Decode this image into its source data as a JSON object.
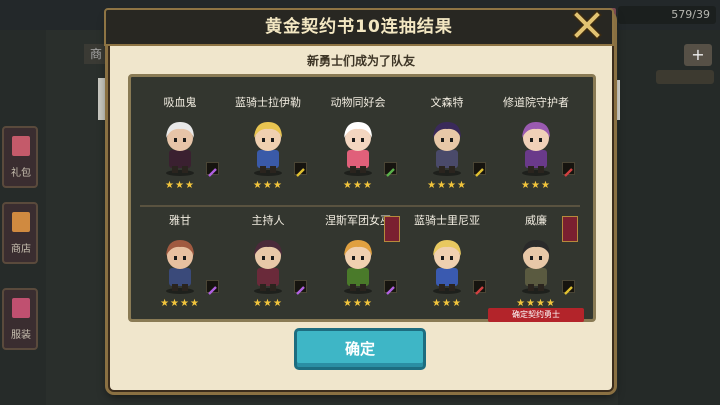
{
  "background": {
    "counter": "579/39",
    "side_buttons": [
      {
        "label": "礼包",
        "color": "#c45a6a"
      },
      {
        "label": "商店",
        "color": "#d08a40"
      },
      {
        "label": "服装",
        "color": "#c05070"
      }
    ],
    "right_tab_label": "商",
    "plus_label": "+"
  },
  "dialog": {
    "title": "黄金契约书10连抽结果",
    "subtitle": "新勇士们成为了队友",
    "confirm_label": "确定"
  },
  "heroes": [
    {
      "name": "吸血鬼",
      "stars": 3,
      "hair": "#e8e8e8",
      "outfit": "#3a2030",
      "skin": "#e6c4a8",
      "weapon": "#b060e0"
    },
    {
      "name": "蓝骑士拉伊勒",
      "stars": 3,
      "hair": "#e8c450",
      "outfit": "#3a5aa8",
      "skin": "#f0d0b0",
      "weapon": "#e0c030"
    },
    {
      "name": "动物同好会",
      "stars": 3,
      "hair": "#ffffff",
      "outfit": "#e0607a",
      "skin": "#f3d6c0",
      "weapon": "#5ab04a"
    },
    {
      "name": "文森特",
      "stars": 4,
      "hair": "#3a2a5a",
      "outfit": "#4a4a6a",
      "skin": "#e8c8a8",
      "weapon": "#e0c030"
    },
    {
      "name": "修道院守护者",
      "stars": 3,
      "hair": "#9a5ab0",
      "outfit": "#6a3a8a",
      "skin": "#f0d0b8",
      "weapon": "#d04040"
    },
    {
      "name": "雅甘",
      "stars": 4,
      "hair": "#a05a40",
      "outfit": "#3a4a7a",
      "skin": "#e8c0a0",
      "weapon": "#b060e0"
    },
    {
      "name": "主持人",
      "stars": 3,
      "hair": "#4a2a3a",
      "outfit": "#6a2a3a",
      "skin": "#e8c8a8",
      "weapon": "#b060e0"
    },
    {
      "name": "涅斯军团女巫",
      "stars": 3,
      "hair": "#e0a040",
      "outfit": "#4a7a2a",
      "skin": "#f0d0b0",
      "weapon": "#b060e0",
      "banner": true
    },
    {
      "name": "蓝骑士里尼亚",
      "stars": 3,
      "hair": "#e8c860",
      "outfit": "#3a5ab0",
      "skin": "#f0d0b0",
      "weapon": "#d04040"
    },
    {
      "name": "威廉",
      "stars": 4,
      "hair": "#2a2a2a",
      "outfit": "#5a5a40",
      "skin": "#e8c8a8",
      "weapon": "#e0c030",
      "banner": true,
      "badge": "确定契约勇士"
    }
  ]
}
